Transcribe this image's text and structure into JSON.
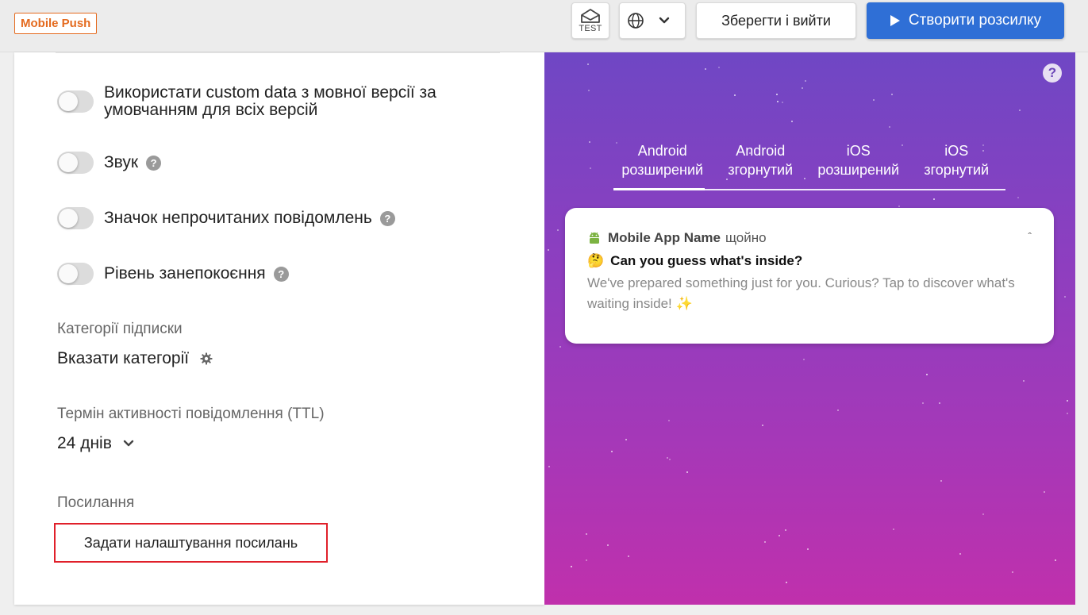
{
  "header": {
    "channel_badge": "Mobile Push",
    "test_label": "TEST",
    "save_label": "Зберегти і вийти",
    "create_label": "Створити розсилку",
    "accent_color": "#2f6fd6",
    "badge_color": "#e46a1e"
  },
  "settings": {
    "toggles": [
      {
        "label": "Використати custom data з мовної версії за умовчанням для всіх версій",
        "enabled": false,
        "help": false
      },
      {
        "label": "Звук",
        "enabled": false,
        "help": true
      },
      {
        "label": "Значок непрочитаних повідомлень",
        "enabled": false,
        "help": true
      },
      {
        "label": "Рівень занепокоєння",
        "enabled": false,
        "help": true
      }
    ],
    "categories": {
      "label": "Категорії підписки",
      "value": "Вказати категорії"
    },
    "ttl": {
      "label": "Термін активності повідомлення (TTL)",
      "value": "24 днів"
    },
    "links": {
      "label": "Посилання",
      "button_label": "Задати налаштування посилань"
    }
  },
  "preview": {
    "help_glyph": "?",
    "tabs": [
      {
        "label_line1": "Android",
        "label_line2": "розширений",
        "active": true
      },
      {
        "label_line1": "Android",
        "label_line2": "згорнутий",
        "active": false
      },
      {
        "label_line1": "iOS",
        "label_line2": "розширений",
        "active": false
      },
      {
        "label_line1": "iOS",
        "label_line2": "згорнутий",
        "active": false
      }
    ],
    "notification": {
      "app_name": "Mobile App Name",
      "time": "щойно",
      "title_emoji": "🤔",
      "title": "Can you guess what's inside?",
      "body": "We've prepared something just for you. Curious? Tap to discover what's waiting inside! ✨"
    }
  }
}
